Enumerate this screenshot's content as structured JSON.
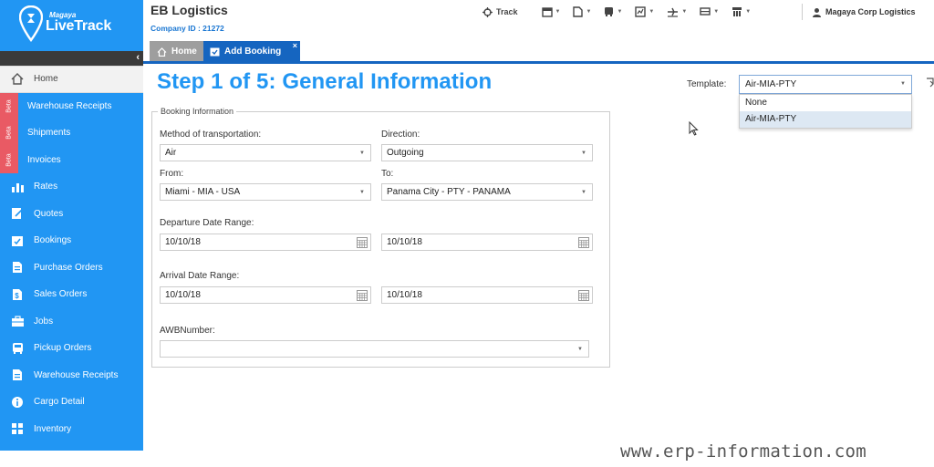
{
  "brand": {
    "small": "Magaya",
    "name": "LiveTrack"
  },
  "sidebar": {
    "items": [
      {
        "label": "Home",
        "icon": "home-icon",
        "active": true
      },
      {
        "label": "Warehouse Receipts",
        "icon": "",
        "beta": "Beta"
      },
      {
        "label": "Shipments",
        "icon": "",
        "beta": "Beta"
      },
      {
        "label": "Invoices",
        "icon": "",
        "beta": "Beta"
      },
      {
        "label": "Rates",
        "icon": "bar-chart-icon"
      },
      {
        "label": "Quotes",
        "icon": "pencil-doc-icon"
      },
      {
        "label": "Bookings",
        "icon": "calendar-check-icon"
      },
      {
        "label": "Purchase Orders",
        "icon": "document-icon"
      },
      {
        "label": "Sales Orders",
        "icon": "dollar-doc-icon"
      },
      {
        "label": "Jobs",
        "icon": "briefcase-icon"
      },
      {
        "label": "Pickup Orders",
        "icon": "bus-icon"
      },
      {
        "label": "Warehouse Receipts",
        "icon": "document-icon"
      },
      {
        "label": "Cargo Detail",
        "icon": "info-icon"
      },
      {
        "label": "Inventory",
        "icon": "grid-icon"
      }
    ]
  },
  "header": {
    "company_name": "EB Logistics",
    "company_id": "Company ID : 21272",
    "track_label": "Track",
    "user_label": "Magaya Corp Logistics"
  },
  "tabs": {
    "home": "Home",
    "add_booking": "Add Booking",
    "close": "×"
  },
  "main": {
    "title": "Step 1 of 5: General Information",
    "template": {
      "label": "Template:",
      "value": "Air-MIA-PTY",
      "options": [
        "None",
        "Air-MIA-PTY"
      ]
    },
    "panel": {
      "legend": "Booking Information",
      "method_label": "Method of transportation:",
      "method_value": "Air",
      "direction_label": "Direction:",
      "direction_value": "Outgoing",
      "from_label": "From:",
      "from_value": "Miami - MIA - USA",
      "to_label": "To:",
      "to_value": "Panama City - PTY - PANAMA",
      "departure_label": "Departure Date Range:",
      "departure_start": "10/10/18",
      "departure_end": "10/10/18",
      "arrival_label": "Arrival Date Range:",
      "arrival_start": "10/10/18",
      "arrival_end": "10/10/18",
      "awb_label": "AWBNumber:",
      "awb_value": ""
    }
  },
  "watermark": "www.erp-information.com",
  "colors": {
    "sidebar": "#2196f3",
    "accent": "#1565c0",
    "beta": "#e95a64"
  }
}
